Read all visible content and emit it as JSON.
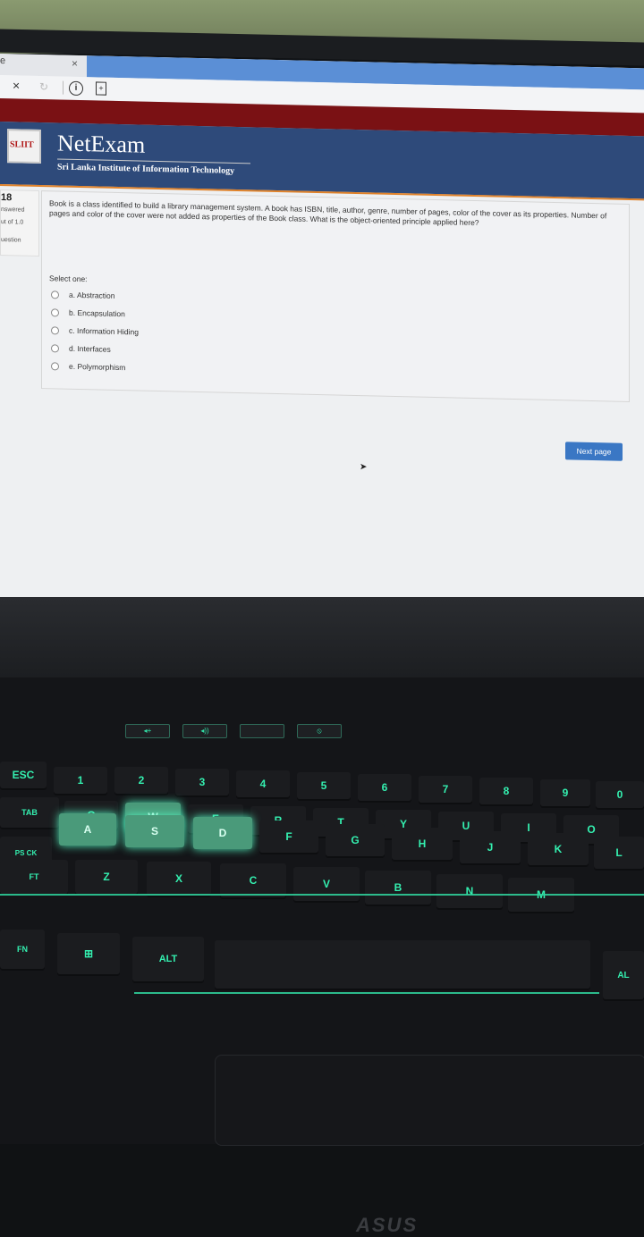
{
  "browser": {
    "tab_label": "e",
    "tab_close": "×",
    "nav_close": "×",
    "nav_reload": "↻",
    "info_glyph": "i",
    "page_glyph": "+"
  },
  "site": {
    "logo_text": "SLIIT",
    "brand": "NetExam",
    "subtitle": "Sri Lanka Institute of Information Technology"
  },
  "question_info": {
    "number": "18",
    "status": "nswered",
    "marks": "ut of 1.0",
    "flag": "uestion"
  },
  "question": {
    "text": "Book is a class identified to build a library management system. A book has ISBN, title, author, genre, number of pages, color of the cover as its properties. Number of pages and color of the cover were not added as properties of the Book class. What is the object-oriented principle applied here?",
    "prompt": "Select one:",
    "options": [
      "a. Abstraction",
      "b. Encapsulation",
      "c. Information Hiding",
      "d. Interfaces",
      "e. Polymorphism"
    ]
  },
  "actions": {
    "next_page": "Next page"
  },
  "laptop": {
    "brand": "ASUS",
    "hotkeys": [
      "◂+",
      "◂))",
      "",
      "⦸",
      "⟳"
    ],
    "keys": {
      "esc": "ESC",
      "one": "1",
      "two": "2",
      "three": "3",
      "four": "4",
      "five": "5",
      "six": "6",
      "seven": "7",
      "eight": "8",
      "nine": "9",
      "zero": "0",
      "tab": "TAB",
      "q": "Q",
      "w": "W",
      "e": "E",
      "r": "R",
      "t": "T",
      "y": "Y",
      "u": "U",
      "i": "I",
      "o": "O",
      "caps": "PS CK",
      "a": "A",
      "s": "S",
      "d": "D",
      "f": "F",
      "g": "G",
      "h": "H",
      "j": "J",
      "k": "K",
      "l": "L",
      "shift": "FT",
      "z": "Z",
      "x": "X",
      "c": "C",
      "v": "V",
      "b": "B",
      "n": "N",
      "m": "M",
      "fn": "FN",
      "win": "⊞",
      "alt": "ALT",
      "alt_r": "AL"
    }
  }
}
